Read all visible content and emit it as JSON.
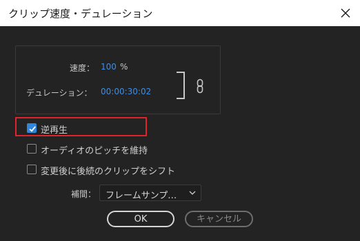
{
  "window": {
    "title": "クリップ速度・デュレーション"
  },
  "speed": {
    "label": "速度：",
    "value": "100",
    "unit": "%"
  },
  "duration": {
    "label": "デュレーション：",
    "value": "00:00:30:02"
  },
  "options": {
    "reverse": {
      "label": "逆再生",
      "checked": true
    },
    "maintain_pitch": {
      "label": "オーディオのピッチを維持",
      "checked": false
    },
    "ripple_edit": {
      "label": "変更後に後続のクリップをシフト",
      "checked": false
    }
  },
  "interpolation": {
    "label": "補間：",
    "value": "フレームサンプ…"
  },
  "buttons": {
    "ok": "OK",
    "cancel": "キャンセル"
  },
  "colors": {
    "accent": "#2f86dc",
    "value_text": "#3d8ee6",
    "highlight": "#e0242e",
    "background": "#232323"
  }
}
